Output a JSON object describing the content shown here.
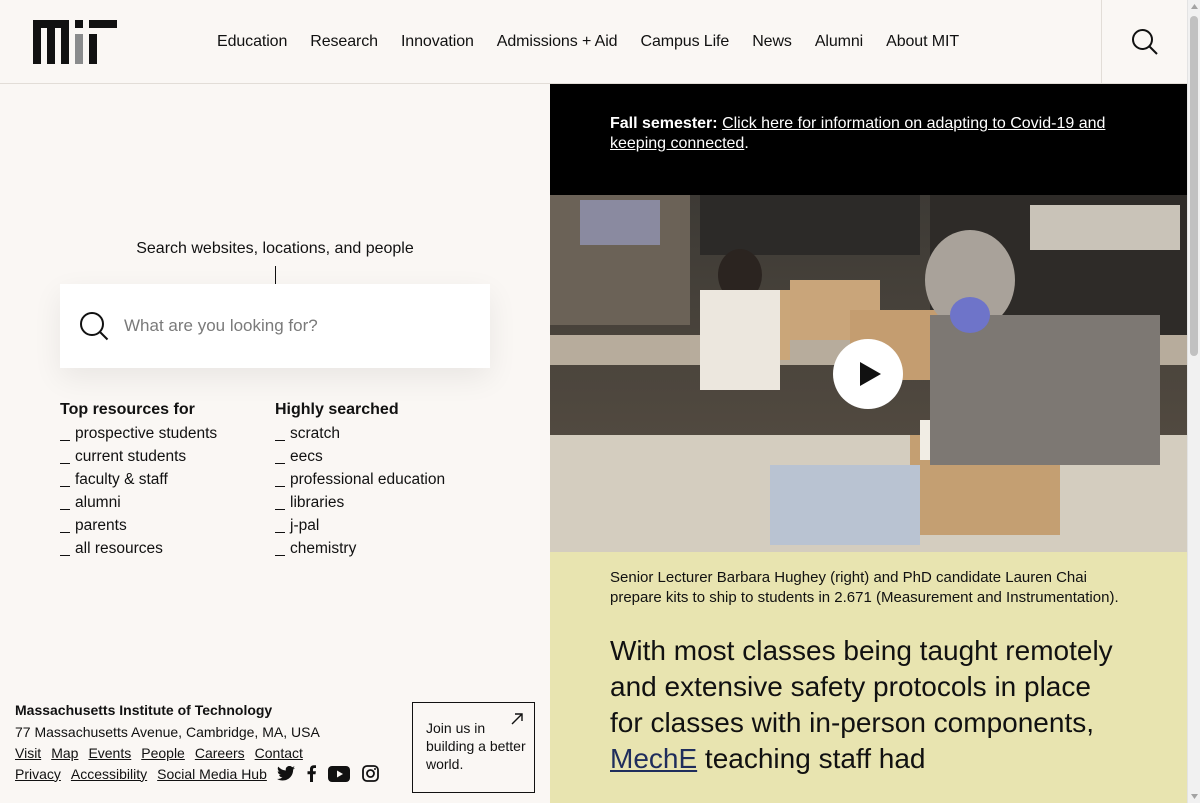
{
  "header": {
    "logo_alt": "MIT",
    "nav": [
      "Education",
      "Research",
      "Innovation",
      "Admissions + Aid",
      "Campus Life",
      "News",
      "Alumni",
      "About MIT"
    ]
  },
  "search": {
    "prompt": "Search websites, locations, and people",
    "placeholder": "What are you looking for?"
  },
  "resources": {
    "top_title": "Top resources for",
    "top_items": [
      "prospective students",
      "current students",
      "faculty & staff",
      "alumni",
      "parents",
      "all resources"
    ],
    "searched_title": "Highly searched",
    "searched_items": [
      "scratch",
      "eecs",
      "professional education",
      "libraries",
      "j-pal",
      "chemistry"
    ]
  },
  "footer": {
    "org": "Massachusetts Institute of Technology",
    "address": "77 Massachusetts Avenue, Cambridge, MA, USA",
    "links_row1": [
      "Visit",
      "Map",
      "Events",
      "People",
      "Careers",
      "Contact"
    ],
    "links_row2": [
      "Privacy",
      "Accessibility",
      "Social Media Hub"
    ],
    "social_icons": [
      "twitter-icon",
      "facebook-icon",
      "youtube-icon",
      "instagram-icon"
    ],
    "join_text": "Join us in building a better world."
  },
  "alert": {
    "label": "Fall semester:",
    "link_text": "Click here for information on adapting to Covid-19 and keeping connected",
    "suffix": "."
  },
  "story": {
    "caption": "Senior Lecturer Barbara Hughey (right) and PhD candidate Lauren Chai prepare kits to ship to students in 2.671 (Measurement and Instrumentation).",
    "headline_before": "With most classes being taught remotely and extensive safety protocols in place for classes with in-person components, ",
    "headline_link": "MechE",
    "headline_after": " teaching staff had"
  },
  "colors": {
    "background": "#faf7f4",
    "alert_bg": "#000000",
    "story_bg": "#e8e4b0",
    "link_accent": "#1f2d5c"
  }
}
